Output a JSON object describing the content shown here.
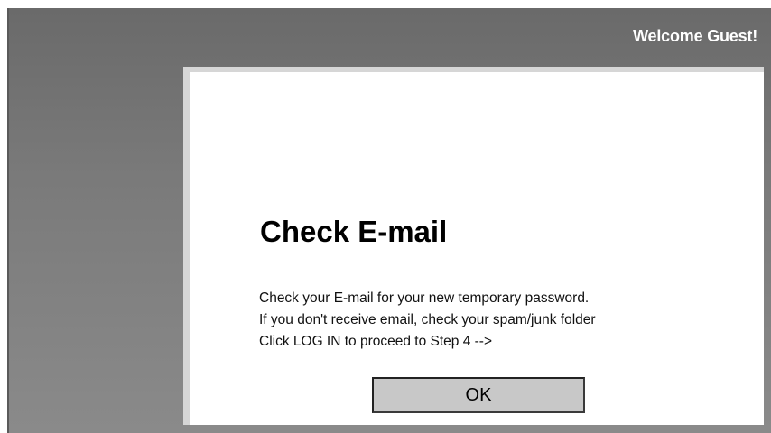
{
  "header": {
    "welcome_text": "Welcome Guest!"
  },
  "dialog": {
    "title": "Check E-mail",
    "lines": [
      "Check your E-mail for your new temporary password.",
      "If you don't receive email, check your spam/junk folder",
      "Click LOG IN to proceed to Step 4 -->"
    ],
    "ok_label": "OK"
  },
  "colors": {
    "frame_gray": "#7a7a7a",
    "content_bg": "#ffffff",
    "button_bg": "#c8c8c8",
    "welcome_text": "#ffffff"
  }
}
